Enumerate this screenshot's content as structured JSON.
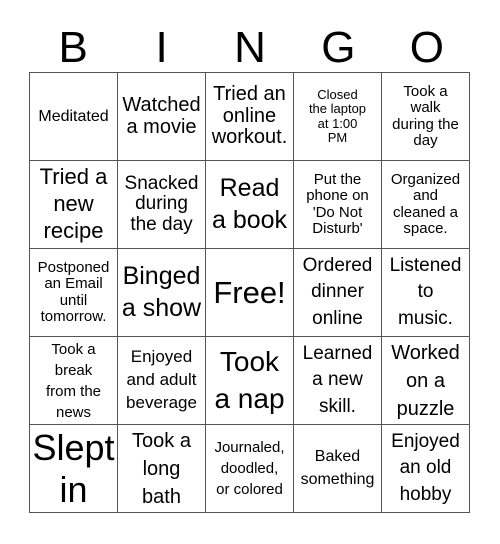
{
  "header": {
    "letters": [
      "B",
      "I",
      "N",
      "G",
      "O"
    ]
  },
  "cells": [
    "Meditated",
    "Watched\na movie",
    "Tried an\nonline\nworkout.",
    "Closed\nthe laptop\nat 1:00\nPM",
    "Took a\nwalk\nduring the\nday",
    "Tried a\nnew\nrecipe",
    "Snacked\nduring\nthe day",
    "Read\na book",
    "Put the\nphone on\n'Do Not\nDisturb'",
    "Organized\nand\ncleaned a\nspace.",
    "Postponed\nan Email\nuntil\ntomorrow.",
    "Binged\na show",
    "Free!",
    "Ordered\ndinner\nonline",
    "Listened\nto\nmusic.",
    "Took a\nbreak\nfrom the\nnews",
    "Enjoyed\nand adult\nbeverage",
    "Took\na nap",
    "Learned\na new\nskill.",
    "Worked\non a\npuzzle",
    "Slept\nin",
    "Took a\nlong\nbath",
    "Journaled,\ndoodled,\nor colored",
    "Baked\nsomething",
    "Enjoyed\nan old\nhobby"
  ]
}
